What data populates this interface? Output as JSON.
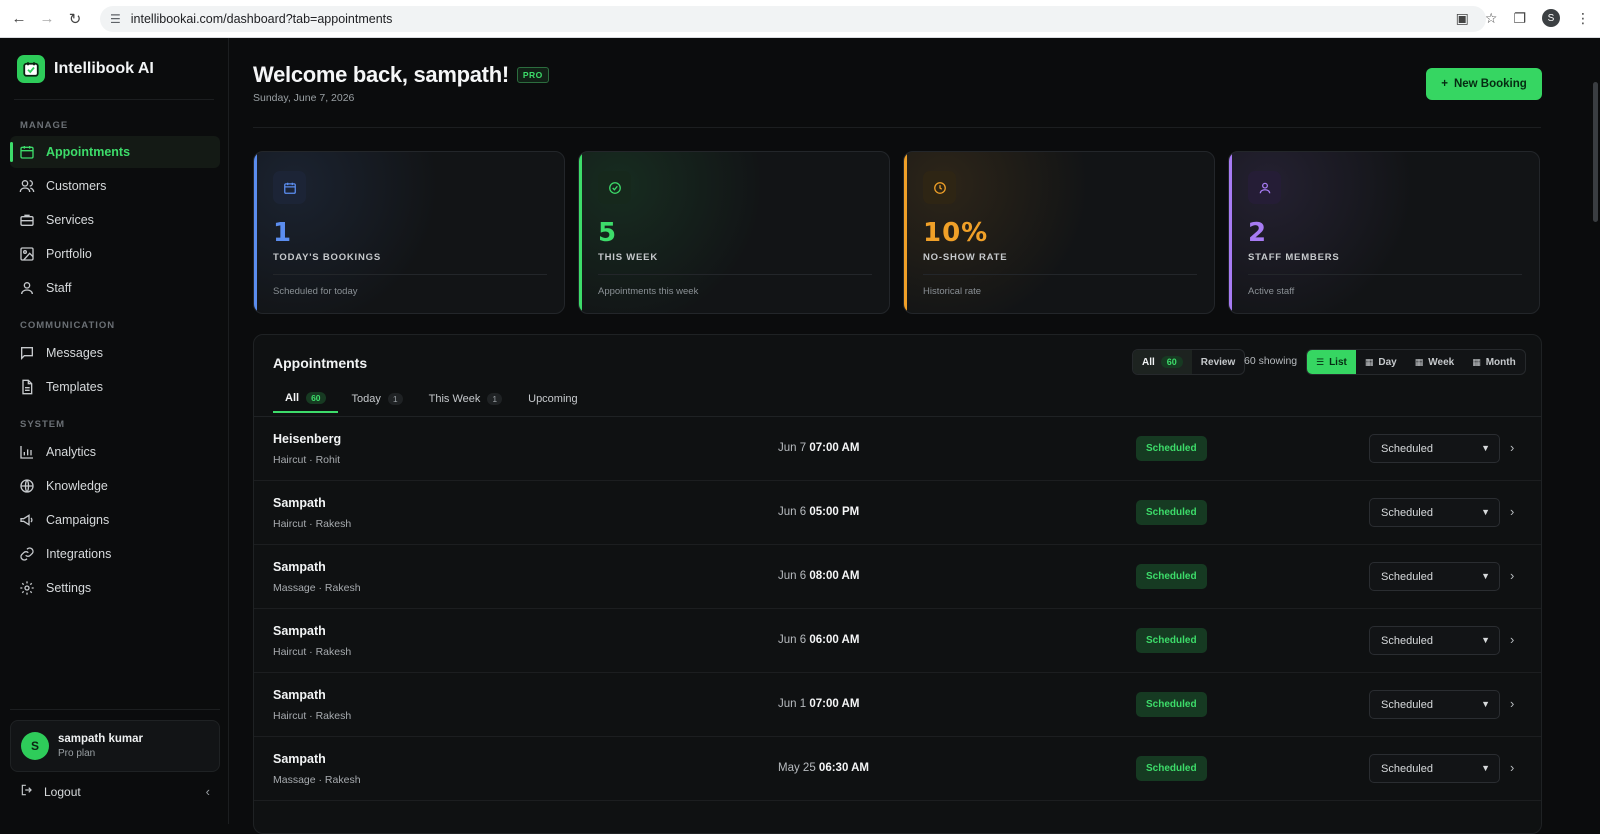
{
  "browser": {
    "url": "intellibookai.com/dashboard?tab=appointments",
    "profile_initial": "S"
  },
  "brand": {
    "name": "Intellibook AI"
  },
  "sidebar": {
    "sections": {
      "manage": "MANAGE",
      "communication": "COMMUNICATION",
      "system": "SYSTEM"
    },
    "items": {
      "appointments": "Appointments",
      "customers": "Customers",
      "services": "Services",
      "portfolio": "Portfolio",
      "staff": "Staff",
      "messages": "Messages",
      "templates": "Templates",
      "analytics": "Analytics",
      "knowledge": "Knowledge",
      "campaigns": "Campaigns",
      "integrations": "Integrations",
      "settings": "Settings"
    },
    "user": {
      "initial": "S",
      "name": "sampath kumar",
      "plan": "Pro plan"
    },
    "logout": "Logout"
  },
  "header": {
    "welcome": "Welcome back, sampath!",
    "badge": "PRO",
    "date": "Sunday, June 7, 2026",
    "new_booking": "New Booking"
  },
  "stats": [
    {
      "value": "1",
      "label": "TODAY'S BOOKINGS",
      "sub": "Scheduled for today",
      "color": "#5b8def"
    },
    {
      "value": "5",
      "label": "THIS WEEK",
      "sub": "Appointments this week",
      "color": "#3ddc6a"
    },
    {
      "value": "10%",
      "label": "NO-SHOW RATE",
      "sub": "Historical rate",
      "color": "#f0a028"
    },
    {
      "value": "2",
      "label": "STAFF MEMBERS",
      "sub": "Active staff",
      "color": "#a77bf3"
    }
  ],
  "appointments": {
    "title": "Appointments",
    "filter": {
      "all": "All",
      "all_count": "60",
      "review": "Review"
    },
    "showing": "60 showing",
    "views": {
      "list": "List",
      "day": "Day",
      "week": "Week",
      "month": "Month"
    },
    "tabs": [
      {
        "label": "All",
        "count": "60"
      },
      {
        "label": "Today",
        "count": "1"
      },
      {
        "label": "This Week",
        "count": "1"
      },
      {
        "label": "Upcoming",
        "count": ""
      }
    ],
    "rows": [
      {
        "name": "Heisenberg",
        "detail": "Haircut · Rohit",
        "date": "Jun 7",
        "time": "07:00 AM",
        "status": "Scheduled",
        "select": "Scheduled"
      },
      {
        "name": "Sampath",
        "detail": "Haircut · Rakesh",
        "date": "Jun 6",
        "time": "05:00 PM",
        "status": "Scheduled",
        "select": "Scheduled"
      },
      {
        "name": "Sampath",
        "detail": "Massage · Rakesh",
        "date": "Jun 6",
        "time": "08:00 AM",
        "status": "Scheduled",
        "select": "Scheduled"
      },
      {
        "name": "Sampath",
        "detail": "Haircut · Rakesh",
        "date": "Jun 6",
        "time": "06:00 AM",
        "status": "Scheduled",
        "select": "Scheduled"
      },
      {
        "name": "Sampath",
        "detail": "Haircut · Rakesh",
        "date": "Jun 1",
        "time": "07:00 AM",
        "status": "Scheduled",
        "select": "Scheduled"
      },
      {
        "name": "Sampath",
        "detail": "Massage · Rakesh",
        "date": "May 25",
        "time": "06:30 AM",
        "status": "Scheduled",
        "select": "Scheduled"
      }
    ]
  },
  "colors": {
    "accent": "#3ddc6a",
    "background": "#0b0c0d"
  }
}
